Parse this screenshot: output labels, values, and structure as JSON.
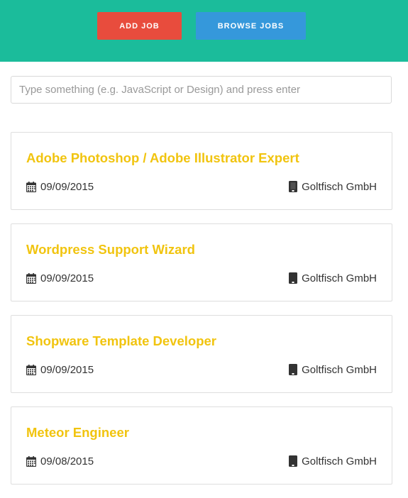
{
  "header": {
    "add_job_label": "ADD JOB",
    "browse_jobs_label": "BROWSE JOBS",
    "background_color": "#1bbc9b",
    "add_job_color": "#e84c3d",
    "browse_jobs_color": "#3598db"
  },
  "search": {
    "placeholder": "Type something (e.g. JavaScript or Design) and press enter",
    "value": ""
  },
  "jobs": [
    {
      "title": "Adobe Photoshop / Adobe Illustrator Expert",
      "date": "09/09/2015",
      "company": "Goltfisch GmbH",
      "date_icon": "calendar-icon",
      "company_icon": "building-icon"
    },
    {
      "title": "Wordpress Support Wizard",
      "date": "09/09/2015",
      "company": "Goltfisch GmbH",
      "date_icon": "calendar-icon",
      "company_icon": "building-icon"
    },
    {
      "title": "Shopware Template Developer",
      "date": "09/09/2015",
      "company": "Goltfisch GmbH",
      "date_icon": "calendar-icon",
      "company_icon": "building-icon"
    },
    {
      "title": "Meteor Engineer",
      "date": "09/08/2015",
      "company": "Goltfisch GmbH",
      "date_icon": "calendar-icon",
      "company_icon": "building-icon"
    }
  ],
  "colors": {
    "job_title": "#f1c40f",
    "meta_text": "#333333"
  }
}
